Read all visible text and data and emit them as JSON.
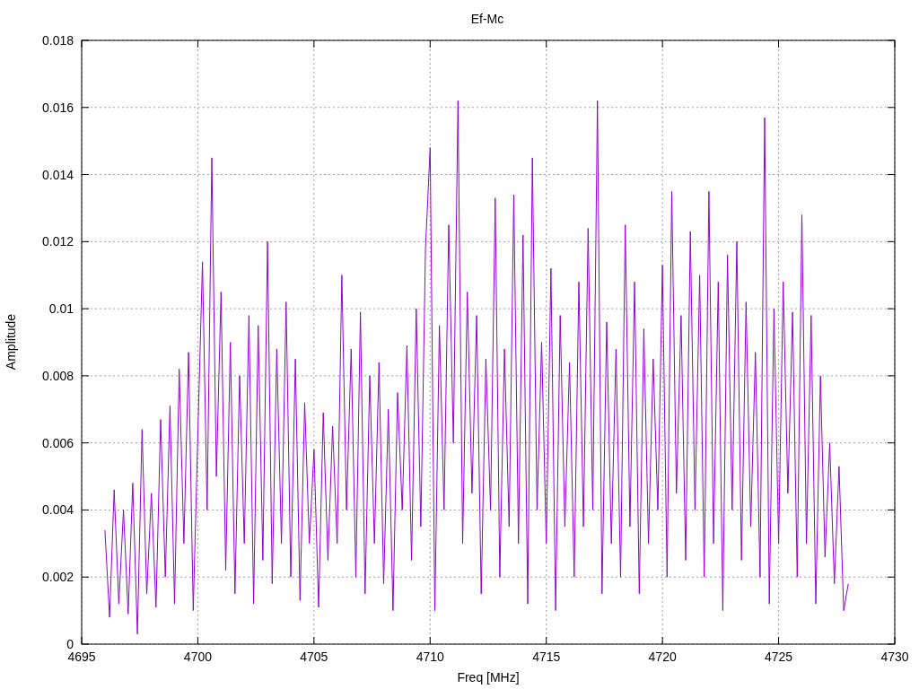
{
  "chart_data": {
    "type": "line",
    "title": "Ef-Mc",
    "xlabel": "Freq [MHz]",
    "ylabel": "Amplitude",
    "grid": true,
    "xlim": [
      4695,
      4730
    ],
    "ylim": [
      0,
      0.018
    ],
    "xticks": [
      4695,
      4700,
      4705,
      4710,
      4715,
      4720,
      4725,
      4730
    ],
    "yticks": [
      0,
      0.002,
      0.004,
      0.006,
      0.008,
      0.01,
      0.012,
      0.014,
      0.016,
      0.018
    ],
    "x": [
      4696,
      4696.2,
      4696.4,
      4696.6,
      4696.8,
      4697,
      4697.2,
      4697.4,
      4697.6,
      4697.8,
      4698,
      4698.2,
      4698.4,
      4698.6,
      4698.8,
      4699,
      4699.2,
      4699.4,
      4699.6,
      4699.8,
      4700,
      4700.2,
      4700.4,
      4700.6,
      4700.8,
      4701,
      4701.2,
      4701.4,
      4701.6,
      4701.8,
      4702,
      4702.2,
      4702.4,
      4702.6,
      4702.8,
      4703,
      4703.2,
      4703.4,
      4703.6,
      4703.8,
      4704,
      4704.2,
      4704.4,
      4704.6,
      4704.8,
      4705,
      4705.2,
      4705.4,
      4705.6,
      4705.8,
      4706,
      4706.2,
      4706.4,
      4706.6,
      4706.8,
      4707,
      4707.2,
      4707.4,
      4707.6,
      4707.8,
      4708,
      4708.2,
      4708.4,
      4708.6,
      4708.8,
      4709,
      4709.2,
      4709.4,
      4709.6,
      4709.8,
      4710,
      4710.2,
      4710.4,
      4710.6,
      4710.8,
      4711,
      4711.2,
      4711.4,
      4711.6,
      4711.8,
      4712,
      4712.2,
      4712.4,
      4712.6,
      4712.8,
      4713,
      4713.2,
      4713.4,
      4713.6,
      4713.8,
      4714,
      4714.2,
      4714.4,
      4714.6,
      4714.8,
      4715,
      4715.2,
      4715.4,
      4715.6,
      4715.8,
      4716,
      4716.2,
      4716.4,
      4716.6,
      4716.8,
      4717,
      4717.2,
      4717.4,
      4717.6,
      4717.8,
      4718,
      4718.2,
      4718.4,
      4718.6,
      4718.8,
      4719,
      4719.2,
      4719.4,
      4719.6,
      4719.8,
      4720,
      4720.2,
      4720.4,
      4720.6,
      4720.8,
      4721,
      4721.2,
      4721.4,
      4721.6,
      4721.8,
      4722,
      4722.2,
      4722.4,
      4722.6,
      4722.8,
      4723,
      4723.2,
      4723.4,
      4723.6,
      4723.8,
      4724,
      4724.2,
      4724.4,
      4724.6,
      4724.8,
      4725,
      4725.2,
      4725.4,
      4725.6,
      4725.8,
      4726,
      4726.2,
      4726.4,
      4726.6,
      4726.8,
      4727,
      4727.2,
      4727.4,
      4727.6,
      4727.8,
      4728
    ],
    "series": [
      {
        "color": "#9400d3",
        "values": [
          0.0034,
          0.0008,
          0.0046,
          0.0012,
          0.004,
          0.0009,
          0.0048,
          0.0003,
          0.0064,
          0.0015,
          0.0045,
          0.0011,
          0.0067,
          0.002,
          0.0071,
          0.0012,
          0.0082,
          0.003,
          0.0087,
          0.001,
          0.0062,
          0.0114,
          0.004,
          0.0145,
          0.005,
          0.0105,
          0.0022,
          0.009,
          0.0015,
          0.008,
          0.003,
          0.0098,
          0.0012,
          0.0095,
          0.0025,
          0.012,
          0.0018,
          0.0088,
          0.003,
          0.0102,
          0.002,
          0.0085,
          0.0013,
          0.0072,
          0.003,
          0.0058,
          0.0011,
          0.0069,
          0.0025,
          0.0065,
          0.003,
          0.011,
          0.004,
          0.0088,
          0.002,
          0.0099,
          0.0015,
          0.008,
          0.003,
          0.0084,
          0.0018,
          0.007,
          0.001,
          0.0075,
          0.004,
          0.0089,
          0.0025,
          0.01,
          0.0035,
          0.0118,
          0.0148,
          0.001,
          0.0095,
          0.004,
          0.0125,
          0.006,
          0.0162,
          0.003,
          0.0105,
          0.0045,
          0.0098,
          0.0015,
          0.0085,
          0.004,
          0.0133,
          0.002,
          0.0088,
          0.0035,
          0.0134,
          0.003,
          0.0122,
          0.0012,
          0.0145,
          0.004,
          0.009,
          0.003,
          0.0112,
          0.001,
          0.0098,
          0.0035,
          0.0084,
          0.002,
          0.0108,
          0.0035,
          0.0124,
          0.004,
          0.0162,
          0.0015,
          0.0096,
          0.003,
          0.0088,
          0.002,
          0.0125,
          0.0035,
          0.0108,
          0.0015,
          0.0094,
          0.003,
          0.0085,
          0.004,
          0.0113,
          0.002,
          0.0135,
          0.0045,
          0.0098,
          0.0025,
          0.0123,
          0.004,
          0.011,
          0.002,
          0.0135,
          0.003,
          0.0108,
          0.001,
          0.0116,
          0.004,
          0.012,
          0.0025,
          0.0102,
          0.0035,
          0.0087,
          0.002,
          0.0157,
          0.0012,
          0.01,
          0.003,
          0.0108,
          0.0045,
          0.0099,
          0.002,
          0.0128,
          0.003,
          0.0098,
          0.0012,
          0.008,
          0.0026,
          0.006,
          0.0018,
          0.0053,
          0.001,
          0.0018
        ]
      }
    ]
  }
}
